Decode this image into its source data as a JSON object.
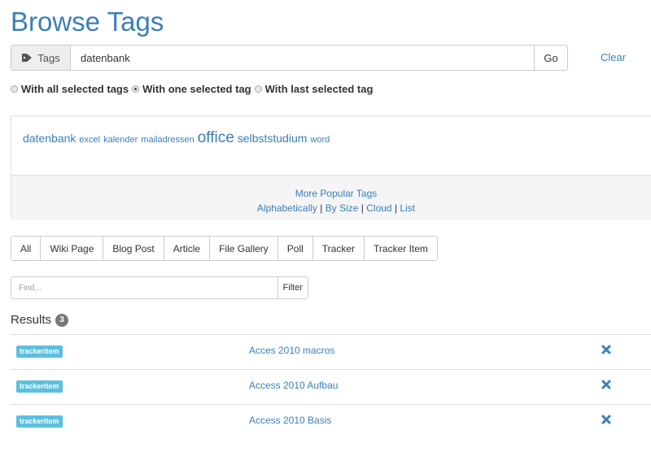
{
  "page": {
    "title": "Browse Tags"
  },
  "search": {
    "addon_label": "Tags",
    "addon_icon": "tag-icon",
    "value": "datenbank",
    "go_label": "Go",
    "clear_label": "Clear"
  },
  "match_options": [
    {
      "label": "With all selected tags",
      "checked": false
    },
    {
      "label": "With one selected tag",
      "checked": true
    },
    {
      "label": "With last selected tag",
      "checked": false
    }
  ],
  "cloud": {
    "tags": [
      {
        "label": "datenbank",
        "size": 14
      },
      {
        "label": "excel",
        "size": 11
      },
      {
        "label": "kalender",
        "size": 11
      },
      {
        "label": "mailadressen",
        "size": 11
      },
      {
        "label": "office",
        "size": 19
      },
      {
        "label": "selbststudium",
        "size": 14
      },
      {
        "label": "word",
        "size": 11
      }
    ],
    "more_label": "More Popular Tags",
    "links": [
      "Alphabetically",
      "By Size",
      "Cloud",
      "List"
    ],
    "separator": "|"
  },
  "types": [
    "All",
    "Wiki Page",
    "Blog Post",
    "Article",
    "File Gallery",
    "Poll",
    "Tracker",
    "Tracker Item"
  ],
  "find": {
    "placeholder": "Find...",
    "button_label": "Filter"
  },
  "results": {
    "heading": "Results",
    "count": "3",
    "items": [
      {
        "type": "trackeritem",
        "title": "Acces 2010 macros"
      },
      {
        "type": "trackeritem",
        "title": "Access 2010 Aufbau"
      },
      {
        "type": "trackeritem",
        "title": "Access 2010 Basis"
      }
    ]
  },
  "colors": {
    "link": "#3a7fb8",
    "label_info": "#5bc0de",
    "badge": "#777777",
    "border": "#cccccc"
  }
}
